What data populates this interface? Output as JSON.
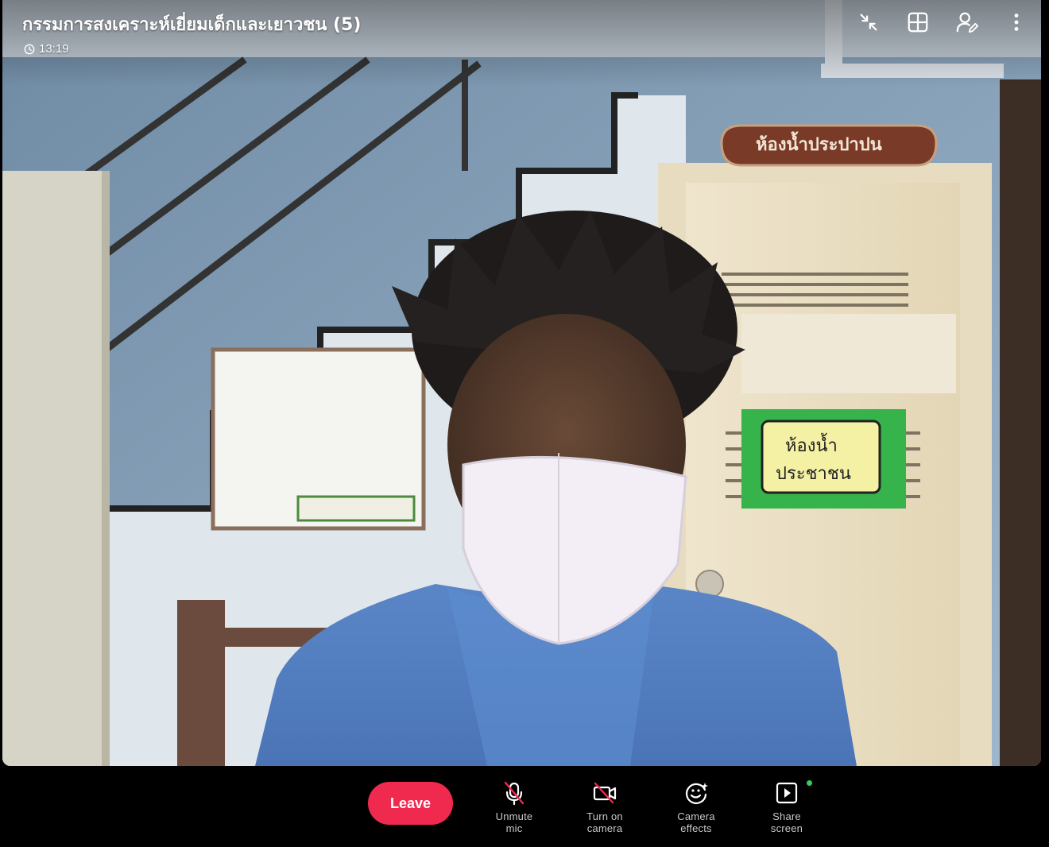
{
  "meeting": {
    "title": "กรรมการสงเคราะห์เยี่ยมเด็กและเยาวชน (5)",
    "elapsed": "13:19"
  },
  "scene_text": {
    "door_sign": "ห้องน้ำประปาปน",
    "restroom_sign_line1": "ห้องน้ำ",
    "restroom_sign_line2": "ประชาชน"
  },
  "top_icons": [
    "collapse-icon",
    "grid-view-icon",
    "participants-settings-icon",
    "more-options-icon"
  ],
  "controls": {
    "leave": "Leave",
    "unmute_mic": {
      "line1": "Unmute",
      "line2": "mic",
      "icon": "mic-off-icon"
    },
    "camera": {
      "line1": "Turn on",
      "line2": "camera",
      "icon": "camera-off-icon"
    },
    "effects": {
      "line1": "Camera",
      "line2": "effects",
      "icon": "camera-effects-icon"
    },
    "share": {
      "line1": "Share",
      "line2": "screen",
      "icon": "share-screen-icon"
    }
  },
  "colors": {
    "leave_button": "#f0294f",
    "muted_slash": "#f0294f",
    "status_dot": "#2fd15c",
    "background": "#000000"
  }
}
